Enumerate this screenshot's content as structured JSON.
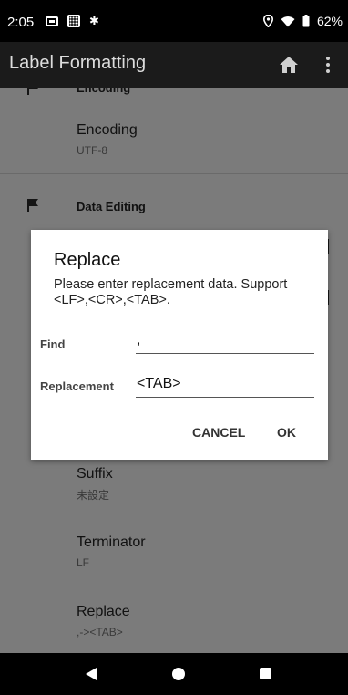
{
  "status": {
    "time": "2:05",
    "battery": "62%",
    "icons": [
      "cast-icon",
      "keyboard-icon",
      "bluetooth-icon",
      "location-icon",
      "wifi-icon",
      "battery-icon"
    ]
  },
  "appbar": {
    "title": "Label Formatting",
    "icons": [
      "home-icon",
      "more-vert-icon"
    ]
  },
  "list": {
    "partial_category": "Encoding",
    "encoding": {
      "title": "Encoding",
      "summary": "UTF-8"
    },
    "data_editing_category": "Data Editing",
    "suffix": {
      "title": "Suffix",
      "summary": "未設定"
    },
    "terminator": {
      "title": "Terminator",
      "summary": "LF"
    },
    "replace": {
      "title": "Replace",
      "summary": ",-><TAB>"
    }
  },
  "dialog": {
    "title": "Replace",
    "message": "Please enter replacement data. Support <LF>,<CR>,<TAB>.",
    "find_label": "Find",
    "find_value": ",",
    "replacement_label": "Replacement",
    "replacement_value": "<TAB>",
    "cancel_label": "CANCEL",
    "ok_label": "OK"
  },
  "colors": {
    "appbar_bg": "#1b1b1b",
    "scrim_content": "#7b7b7b",
    "dialog_bg": "#ffffff"
  }
}
